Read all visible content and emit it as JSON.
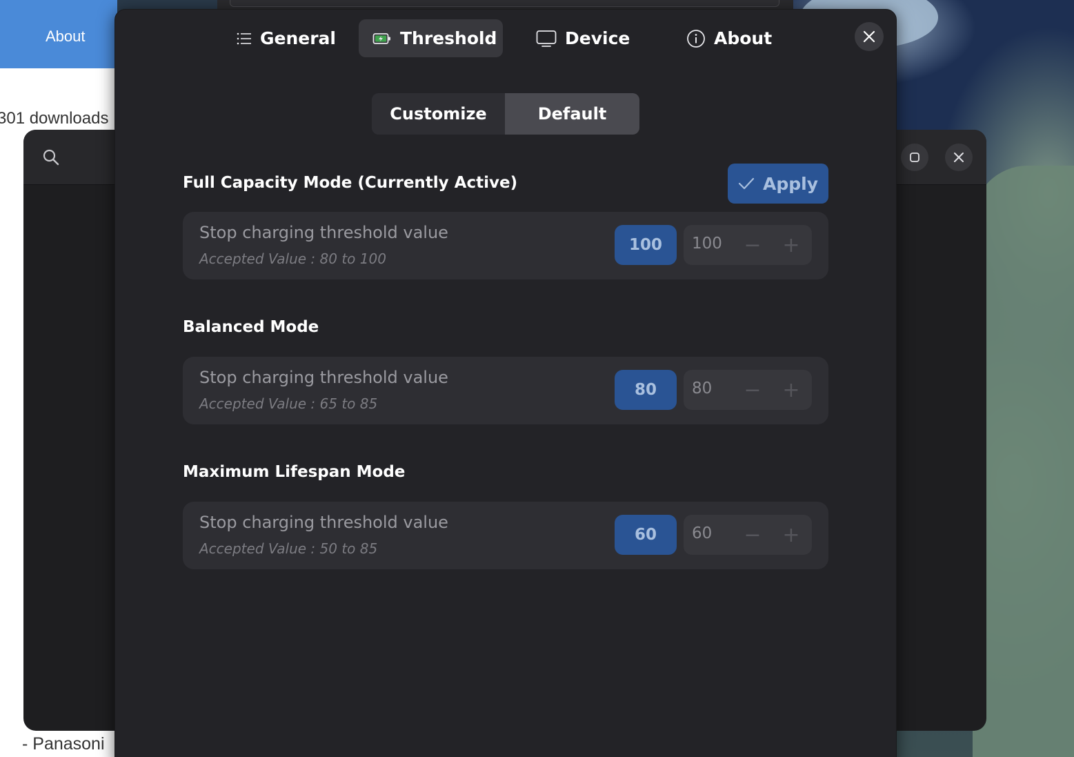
{
  "background_browser": {
    "about_link": "About",
    "downloads_text": "301 downloads",
    "bottom_text": "- Panasoni"
  },
  "dialog": {
    "tabs": [
      {
        "label": "General",
        "icon": "list-icon",
        "active": false
      },
      {
        "label": "Threshold",
        "icon": "battery-charging-icon",
        "active": true
      },
      {
        "label": "Device",
        "icon": "monitor-icon",
        "active": false
      },
      {
        "label": "About",
        "icon": "info-icon",
        "active": false
      }
    ],
    "segmented": {
      "customize_label": "Customize",
      "default_label": "Default",
      "selected": "Default"
    },
    "apply_label": "Apply",
    "sections": [
      {
        "title": "Full Capacity Mode (Currently Active)",
        "row_title": "Stop charging threshold value",
        "row_subtitle": "Accepted Value : 80 to 100",
        "badge_value": "100",
        "spin_value": "100"
      },
      {
        "title": "Balanced Mode",
        "row_title": "Stop charging threshold value",
        "row_subtitle": "Accepted Value : 65 to 85",
        "badge_value": "80",
        "spin_value": "80"
      },
      {
        "title": "Maximum Lifespan Mode",
        "row_title": "Stop charging threshold value",
        "row_subtitle": "Accepted Value : 50 to 85",
        "badge_value": "60",
        "spin_value": "60"
      }
    ],
    "spin_minus": "−",
    "spin_plus": "+"
  },
  "colors": {
    "accent": "#2a5494",
    "accent_text": "#a9c0df",
    "dialog_bg": "#232327",
    "row_bg": "#2e2e33"
  }
}
